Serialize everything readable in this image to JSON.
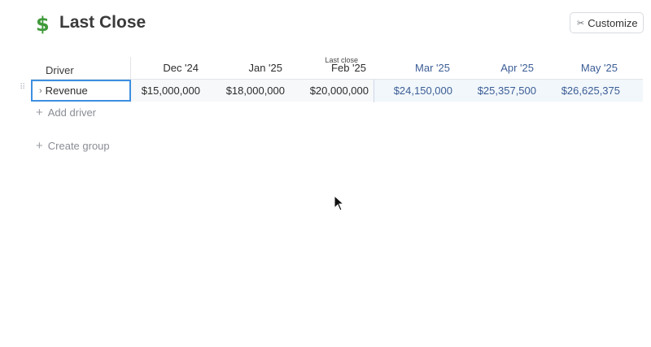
{
  "header": {
    "icon": "$",
    "title": "Last Close",
    "customize_label": "Customize",
    "customize_icon": "scissors-icon"
  },
  "table": {
    "driver_header": "Driver",
    "last_close_marker": "Last close",
    "columns": [
      {
        "label": "Dec '24",
        "kind": "actual"
      },
      {
        "label": "Jan '25",
        "kind": "actual"
      },
      {
        "label": "Feb '25",
        "kind": "actual"
      },
      {
        "label": "Mar '25",
        "kind": "forecast"
      },
      {
        "label": "Apr '25",
        "kind": "forecast"
      },
      {
        "label": "May '25",
        "kind": "forecast"
      }
    ],
    "rows": [
      {
        "name": "Revenue",
        "values": [
          "$15,000,000",
          "$18,000,000",
          "$20,000,000",
          "$24,150,000",
          "$25,357,500",
          "$26,625,375"
        ]
      }
    ]
  },
  "actions": {
    "add_driver": "Add driver",
    "create_group": "Create group"
  },
  "colors": {
    "forecast_text": "#3c5d96",
    "selection_border": "#3d8fe0",
    "title_icon": "#3f9a3a"
  }
}
